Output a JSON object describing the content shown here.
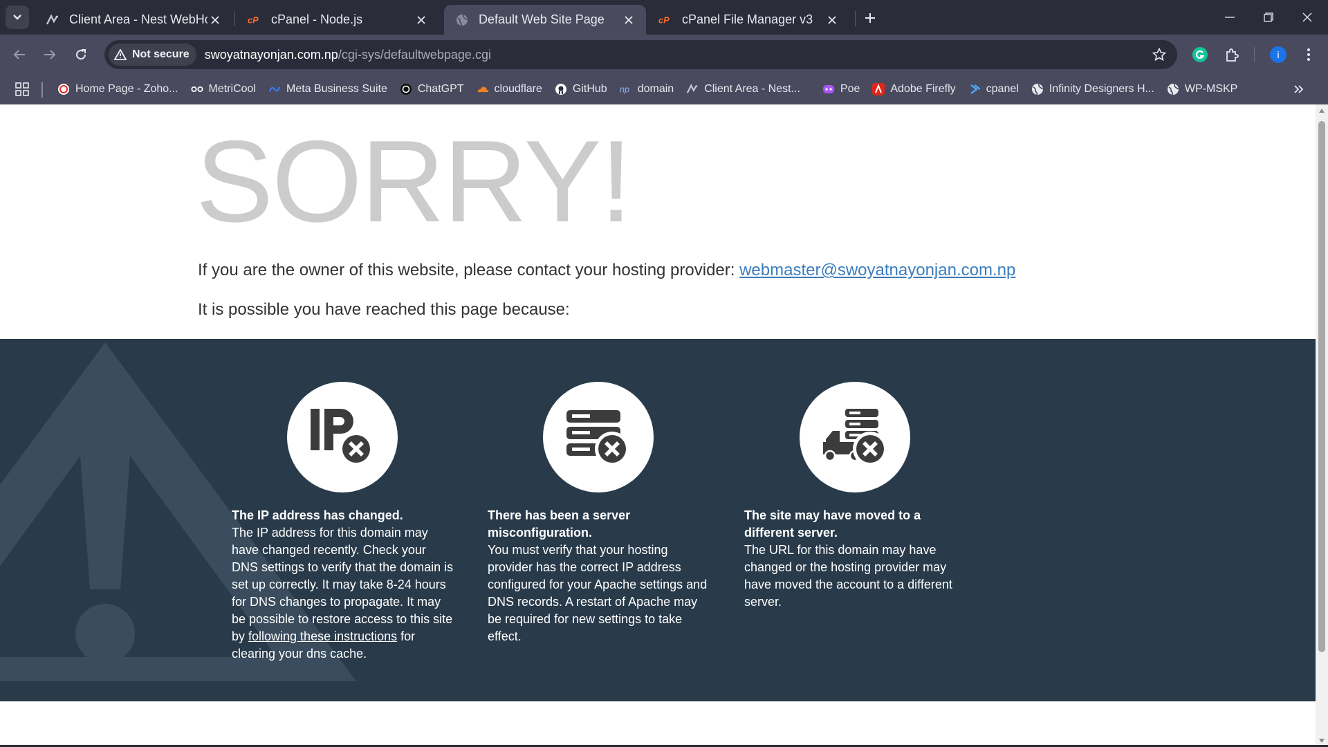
{
  "browser": {
    "tabs": [
      {
        "title": "Client Area - Nest WebHost",
        "icon": "nest-favicon-icon",
        "active": false
      },
      {
        "title": "cPanel - Node.js",
        "icon": "cpanel-favicon-icon",
        "active": false
      },
      {
        "title": "Default Web Site Page",
        "icon": "globe-favicon-icon",
        "active": true
      },
      {
        "title": "cPanel File Manager v3",
        "icon": "cpanel-favicon-icon",
        "active": false
      }
    ],
    "security_label": "Not secure",
    "url_domain": "swoyatnayonjan.com.np",
    "url_path": "/cgi-sys/defaultwebpage.cgi",
    "profile_initial": "i",
    "bookmarks": [
      {
        "label": "Home Page - Zoho...",
        "icon": "zoho-icon"
      },
      {
        "label": "MetriCool",
        "icon": "metricool-icon"
      },
      {
        "label": "Meta Business Suite",
        "icon": "meta-icon"
      },
      {
        "label": "ChatGPT",
        "icon": "chatgpt-icon"
      },
      {
        "label": "cloudflare",
        "icon": "cloudflare-icon"
      },
      {
        "label": "GitHub",
        "icon": "github-icon"
      },
      {
        "label": "domain",
        "icon": "domain-icon"
      },
      {
        "label": "Client Area - Nest...",
        "icon": "nest-favicon-icon"
      },
      {
        "label": "Poe",
        "icon": "poe-icon"
      },
      {
        "label": "Adobe Firefly",
        "icon": "adobe-icon"
      },
      {
        "label": "cpanel",
        "icon": "cpanel-bookmark-icon"
      },
      {
        "label": "Infinity Designers H...",
        "icon": "globe-icon"
      },
      {
        "label": "WP-MSKP",
        "icon": "globe-icon"
      }
    ],
    "colors": {
      "chrome_dark": "#2b2c3a",
      "chrome_mid": "#494a5e",
      "grammarly": "#15c39a",
      "profile": "#1a73e8"
    }
  },
  "page": {
    "headline": "SORRY!",
    "owner_text": "If you are the owner of this website, please contact your hosting provider: ",
    "owner_email": "webmaster@swoyatnayonjan.com.np",
    "possible_text": "It is possible you have reached this page because:",
    "reasons": [
      {
        "icon": "ip-error-icon",
        "title": "The IP address has changed.",
        "body_before": "The IP address for this domain may have changed recently. Check your DNS settings to verify that the domain is set up correctly. It may take 8-24 hours for DNS changes to propagate. It may be possible to restore access to this site by ",
        "link": "following these instructions",
        "body_after": " for clearing your dns cache."
      },
      {
        "icon": "server-error-icon",
        "title": "There has been a server misconfiguration.",
        "body_before": "You must verify that your hosting provider has the correct IP address configured for your Apache settings and DNS records. A restart of Apache may be required for new settings to take effect."
      },
      {
        "icon": "server-moved-icon",
        "title": "The site may have moved to a different server.",
        "body_before": "The URL for this domain may have changed or the hosting provider may have moved the account to a different server."
      }
    ],
    "colors": {
      "band": "#293a4a",
      "headline": "#cccccc",
      "link": "#3a7dbd",
      "text": "#333333"
    }
  }
}
